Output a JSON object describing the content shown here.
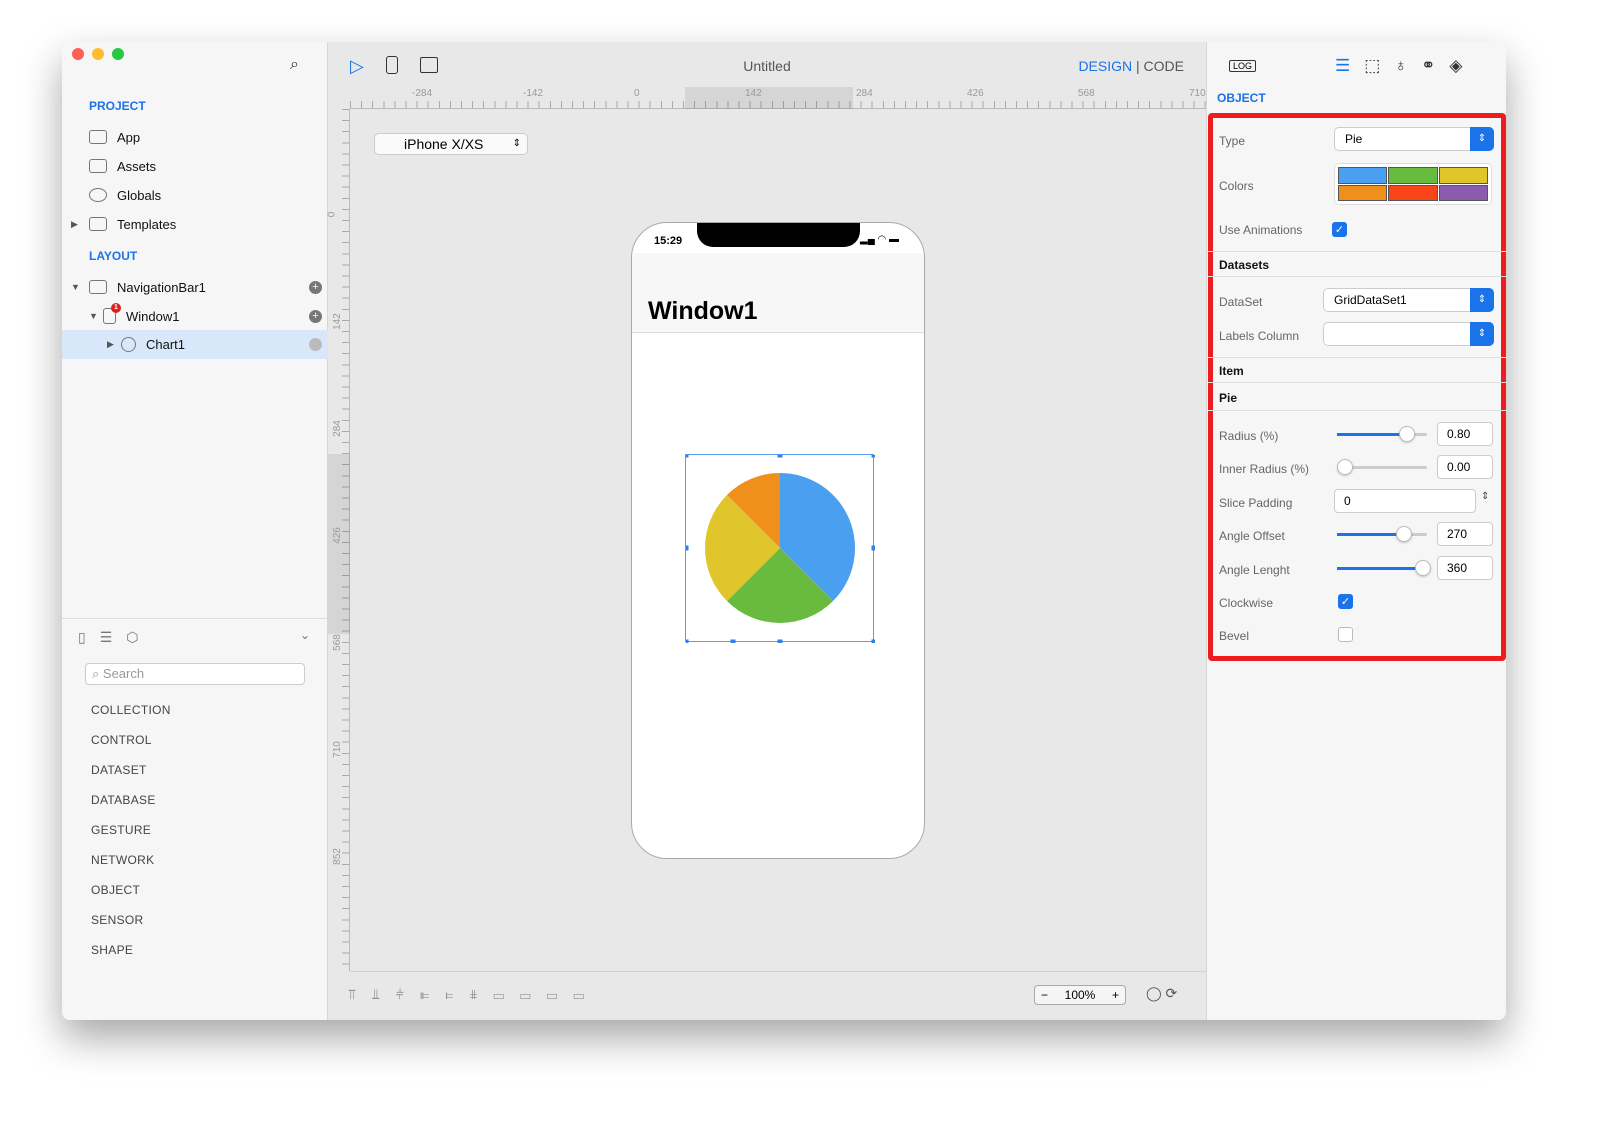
{
  "window": {
    "title": "Untitled",
    "mode_design": "DESIGN",
    "mode_sep": "|",
    "mode_code": "CODE"
  },
  "sidebar": {
    "project_label": "PROJECT",
    "project_items": [
      {
        "label": "App"
      },
      {
        "label": "Assets"
      },
      {
        "label": "Globals"
      },
      {
        "label": "Templates"
      }
    ],
    "layout_label": "LAYOUT",
    "layout_items": [
      {
        "label": "NavigationBar1"
      },
      {
        "label": "Window1",
        "badge": "1"
      },
      {
        "label": "Chart1"
      }
    ],
    "search_placeholder": "Search",
    "library": [
      "COLLECTION",
      "CONTROL",
      "DATASET",
      "DATABASE",
      "GESTURE",
      "NETWORK",
      "OBJECT",
      "SENSOR",
      "SHAPE"
    ]
  },
  "canvas": {
    "device": "iPhone X/XS",
    "ruler_h": [
      "-284",
      "-142",
      "0",
      "142",
      "284",
      "426",
      "568",
      "710"
    ],
    "ruler_v": [
      "0",
      "142",
      "284",
      "426",
      "568",
      "710",
      "852"
    ],
    "zoom": "100%",
    "zoom_minus": "−",
    "zoom_plus": "+"
  },
  "phone": {
    "time": "15:29",
    "title": "Window1",
    "pie_fractions": [
      0.375,
      0.25,
      0.25,
      0.125
    ],
    "pie_colors": [
      "#4a9ff0",
      "#69bb3f",
      "#e0c62a",
      "#ef8f1c"
    ]
  },
  "inspector": {
    "log": "LOG",
    "section": "OBJECT",
    "type_label": "Type",
    "type_value": "Pie",
    "colors_label": "Colors",
    "colors": [
      "#4a9ff0",
      "#69bb3f",
      "#e0c62a",
      "#ef8f1c",
      "#f8461a",
      "#8b5bb0"
    ],
    "use_animations_label": "Use Animations",
    "use_animations": true,
    "datasets_header": "Datasets",
    "dataset_label": "DataSet",
    "dataset_value": "GridDataSet1",
    "labels_column_label": "Labels Column",
    "labels_column_value": "",
    "item_header": "Item",
    "pie_header": "Pie",
    "radius_label": "Radius (%)",
    "radius_value": "0.80",
    "radius_fraction": 0.8,
    "inner_radius_label": "Inner Radius (%)",
    "inner_radius_value": "0.00",
    "inner_fraction": 0,
    "slice_padding_label": "Slice Padding",
    "slice_padding_value": "0",
    "angle_offset_label": "Angle Offset",
    "angle_offset_value": "270",
    "angle_offset_fraction": 0.75,
    "angle_length_label": "Angle Lenght",
    "angle_length_value": "360",
    "angle_length_fraction": 1,
    "clockwise_label": "Clockwise",
    "clockwise": true,
    "bevel_label": "Bevel",
    "bevel": false,
    "highlight_color": "#ee1c1c",
    "accent": "#1a73e8"
  }
}
